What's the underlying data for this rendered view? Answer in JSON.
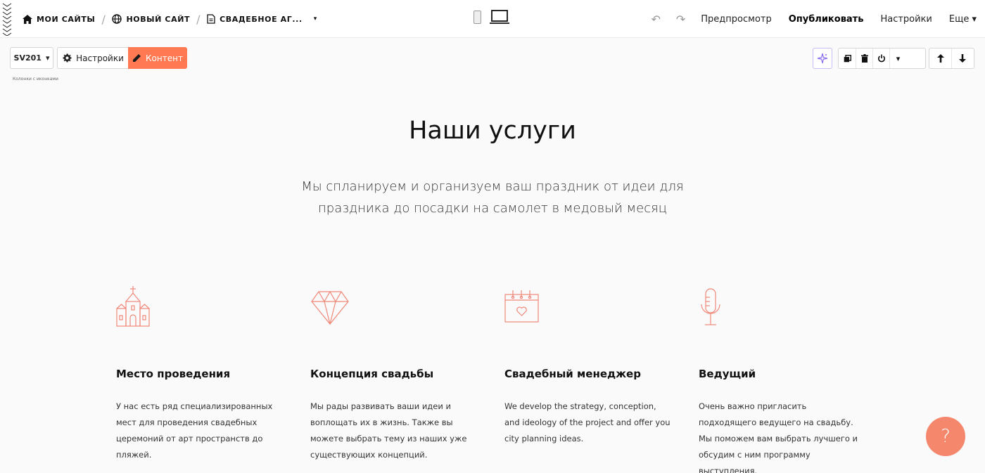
{
  "topbar": {
    "breadcrumbs": [
      "МОИ САЙТЫ",
      "НОВЫЙ САЙТ",
      "СВАДЕБНОЕ АГ..."
    ],
    "separator": "/",
    "caret": "▾",
    "actions": {
      "undo": "↶",
      "redo": "↷",
      "preview": "Предпросмотр",
      "publish": "Опубликовать",
      "settings": "Настройки",
      "more": "Еще ▾"
    }
  },
  "block_toolbar": {
    "block_id": "SV201",
    "caret": "▾",
    "settings_label": "Настройки",
    "content_label": "Контент",
    "block_name": "Колонки с иконками",
    "accent_color": "#ff7a52"
  },
  "page": {
    "title": "Наши услуги",
    "subtitle_line1": "Мы спланируем и организуем ваш праздник от идеи для",
    "subtitle_line2": "праздника до посадки на самолет в медовый месяц",
    "columns": [
      {
        "icon": "church-icon",
        "title": "Место проведения",
        "text": "У нас есть ряд специализированных мест для проведения свадебных церемоний от арт пространств до пляжей."
      },
      {
        "icon": "diamond-icon",
        "title": "Концепция свадьбы",
        "text": "Мы рады развивать ваши идеи и воплощать их в жизнь. Также вы можете выбрать тему из наших уже существующих концепций."
      },
      {
        "icon": "calendar-heart-icon",
        "title": "Свадебный менеджер",
        "text": "We develop the strategy, conception, and ideology of the project and offer you city planning ideas."
      },
      {
        "icon": "microphone-icon",
        "title": "Ведущий",
        "text": "Очень важно пригласить подходящего ведущего на свадьбу. Мы поможем вам выбрать лучшего и обсудим с ним программу выступления."
      }
    ],
    "icon_color": "#f08878"
  },
  "help": {
    "label": "?"
  }
}
